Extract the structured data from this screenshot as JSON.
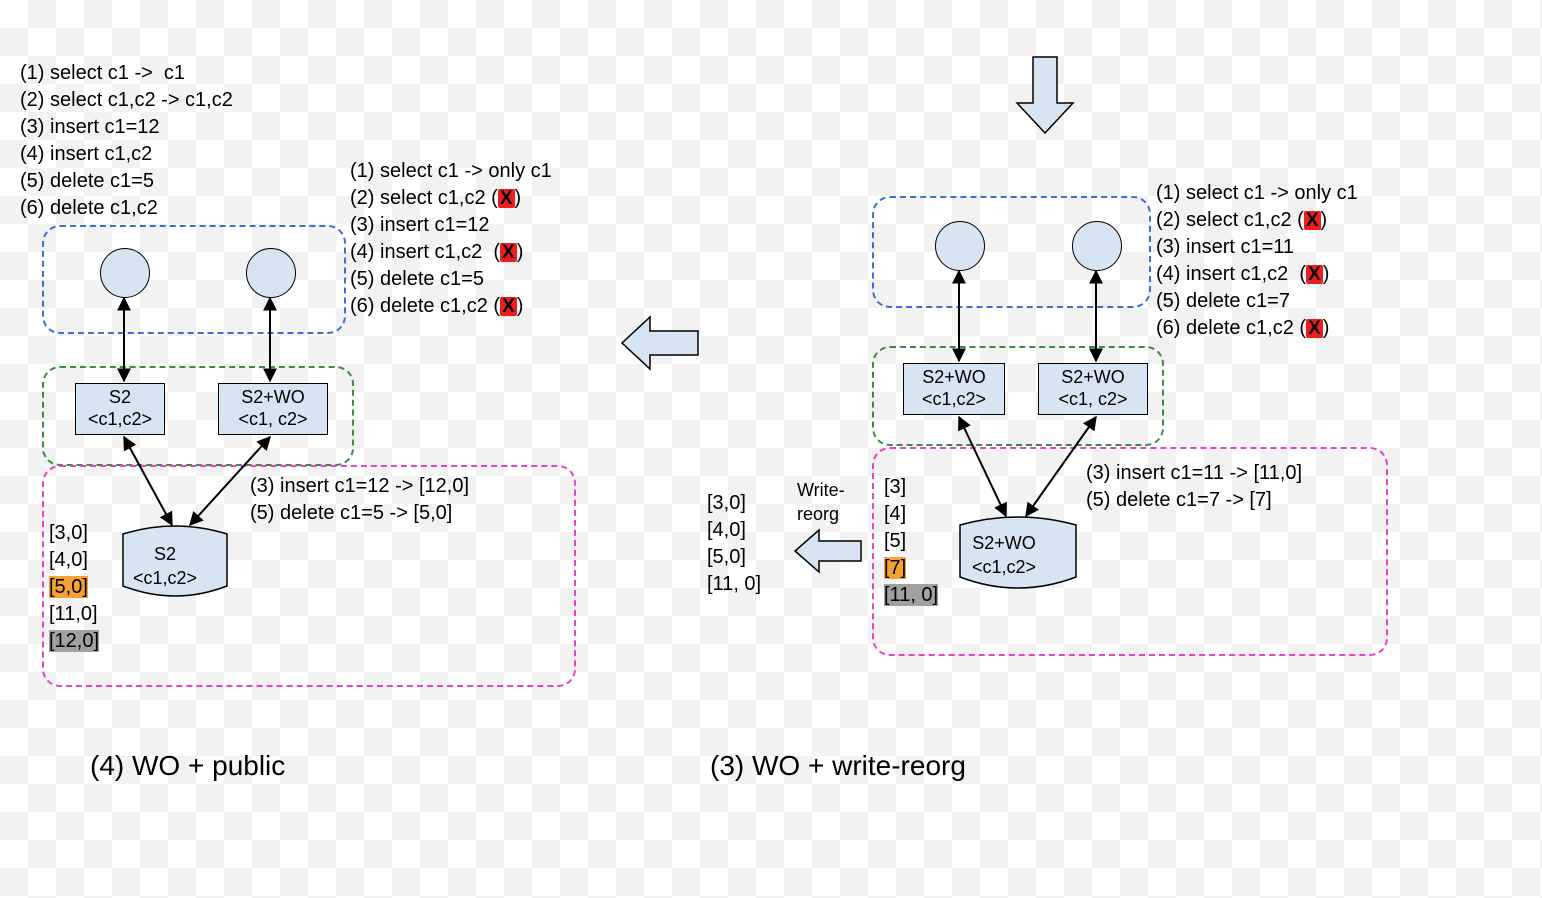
{
  "left": {
    "top_list": "(1) select c1 ->  c1\n(2) select c1,c2 -> c1,c2\n(3) insert c1=12\n(4) insert c1,c2\n(5) delete c1=5\n(6) delete c1,c2",
    "right_list": {
      "l1": "(1) select c1 -> only c1",
      "l2a": "(2) select c1,c2 (",
      "l2x": "X",
      "l2b": ")",
      "l3": "(3) insert c1=12",
      "l4a": "(4) insert c1,c2  (",
      "l4x": "X",
      "l4b": ")",
      "l5": "(5) delete c1=5",
      "l6a": "(6) delete c1,c2 (",
      "l6x": "X",
      "l6b": ")"
    },
    "boxes": {
      "s2": "S2\n<c1,c2>",
      "s2wo": "S2+WO\n<c1, c2>",
      "doc": "S2\n<c1,c2>"
    },
    "ops_note": "(3) insert c1=12 -> [12,0]\n(5) delete c1=5 -> [5,0]",
    "data": {
      "r1": "[3,0]",
      "r2": "[4,0]",
      "r3": "[5,0]",
      "r4": "[11,0]",
      "r5": "[12,0]"
    },
    "title": "(4) WO + public"
  },
  "right": {
    "right_list": {
      "l1": "(1) select c1 -> only c1",
      "l2a": "(2) select c1,c2 (",
      "l2x": "X",
      "l2b": ")",
      "l3": "(3) insert c1=11",
      "l4a": "(4) insert c1,c2  (",
      "l4x": "X",
      "l4b": ")",
      "l5": "(5) delete c1=7",
      "l6a": "(6) delete c1,c2 (",
      "l6x": "X",
      "l6b": ")"
    },
    "boxes": {
      "s2wo_a": "S2+WO\n<c1,c2>",
      "s2wo_b": "S2+WO\n<c1, c2>",
      "doc": "S2+WO\n<c1,c2>"
    },
    "ops_note": "(3) insert c1=11 -> [11,0]\n(5) delete c1=7 -> [7]",
    "mid_note": "Write-\nreorg",
    "data_out": "[3,0]\n[4,0]\n[5,0]\n[11, 0]",
    "data_in": {
      "r1": "[3]",
      "r2": "[4]",
      "r3": "[5]",
      "r4": "[7]",
      "r5": "[11, 0]"
    },
    "title": "(3) WO + write-reorg"
  }
}
